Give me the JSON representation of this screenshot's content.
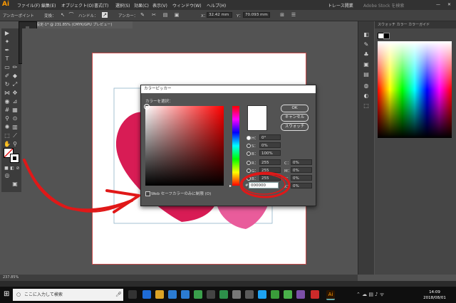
{
  "app": {
    "logo": "Ai"
  },
  "menu": [
    "ファイル(F)",
    "編集(E)",
    "オブジェクト(O)",
    "書式(T)",
    "選択(S)",
    "効果(C)",
    "表示(V)",
    "ウィンドウ(W)",
    "ヘルプ(H)"
  ],
  "menu_right": {
    "workspace": "トレース開業",
    "search_placeholder": "Adobe Stock を検索"
  },
  "control": {
    "label_left": "アンカーポイント",
    "convert": "変換：",
    "handle": "ハンドル：",
    "anchor": "アンカー：",
    "x_label": "X：",
    "x_value": "32.42 mm",
    "y_label": "Y：",
    "y_value": "70.093 mm"
  },
  "doc_tab": "未設定-1* @ 231.85% (CMYK/GPU プレビュー)",
  "tooltip_num": "2",
  "status": {
    "zoom": "237.85%"
  },
  "panels": {
    "tabs": "スウォッチ  カラー  カラーガイド"
  },
  "dialog": {
    "title": "カラーピッカー",
    "subtitle": "カラーを選択：",
    "ok": "OK",
    "cancel": "キャンセル",
    "swatches": "スウォッチ",
    "hsb": [
      {
        "label": "H：",
        "value": "0°"
      },
      {
        "label": "S：",
        "value": "0%"
      },
      {
        "label": "B：",
        "value": "100%"
      }
    ],
    "rgb": [
      {
        "label": "R：",
        "value": "255"
      },
      {
        "label": "G：",
        "value": "255"
      },
      {
        "label": "B：",
        "value": "255"
      }
    ],
    "cmyk": [
      {
        "label": "C：",
        "value": "0%"
      },
      {
        "label": "M：",
        "value": "0%"
      },
      {
        "label": "Y：",
        "value": "0%"
      },
      {
        "label": "K：",
        "value": "0%"
      }
    ],
    "hex_label": "#",
    "hex_value": "000000",
    "web_only": "Web セーフカラーのみに制限 (O)"
  },
  "taskbar": {
    "search_placeholder": "ここに入力して検索",
    "time": "14:09",
    "date": "2018/08/01"
  },
  "colors": {
    "accent_red": "#e0173a",
    "heart_red": "#d81c55",
    "heart_pink": "#e95c9b",
    "arrow": "#e01818"
  }
}
